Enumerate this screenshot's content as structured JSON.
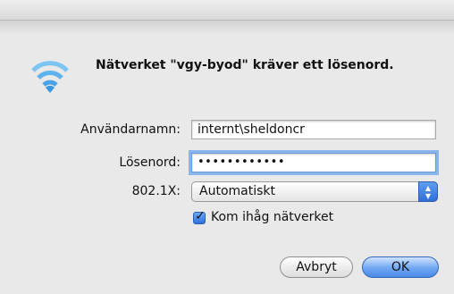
{
  "dialog": {
    "message": "Nätverket \"vgy-byod\" kräver ett lösenord.",
    "icon": "wifi-icon",
    "accent_color": "#4aa3e8"
  },
  "form": {
    "username_label": "Användarnamn:",
    "username_value": "internt\\sheldoncr",
    "password_label": "Lösenord:",
    "password_value": "••••••••••••",
    "security_label": "802.1X:",
    "security_value": "Automatiskt",
    "remember_label": "Kom ihåg nätverket",
    "remember_checked": true
  },
  "buttons": {
    "cancel_label": "Avbryt",
    "ok_label": "OK"
  }
}
